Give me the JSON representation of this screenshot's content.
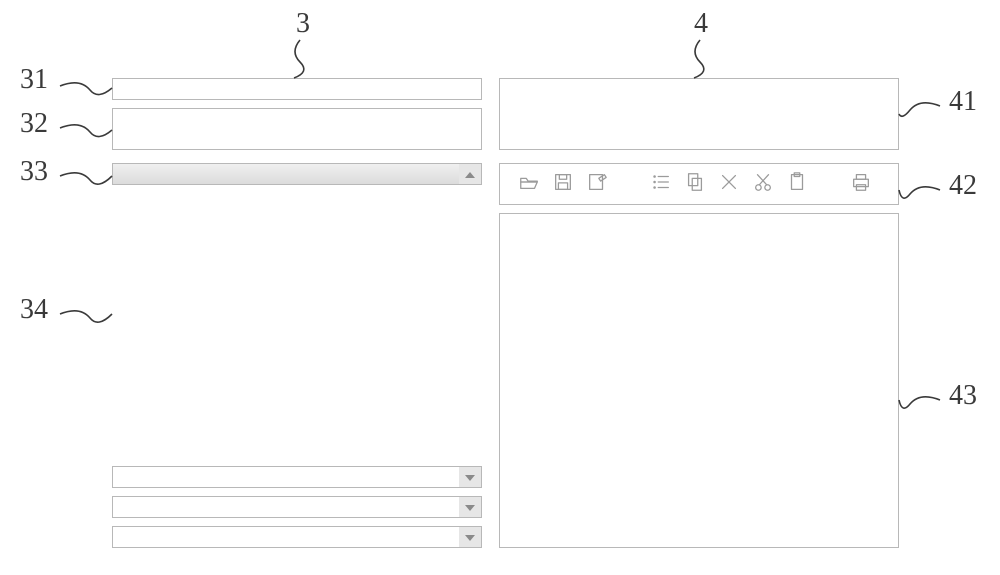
{
  "labels": {
    "l3": "3",
    "l4": "4",
    "l31": "31",
    "l32": "32",
    "l33": "33",
    "l34": "34",
    "l41": "41",
    "l42": "42",
    "l43": "43"
  },
  "toolbar": {
    "icons": [
      "open-folder-icon",
      "save-icon",
      "edit-icon",
      "list-icon",
      "copy-icon",
      "delete-icon",
      "cut-icon",
      "paste-icon",
      "print-icon"
    ]
  }
}
